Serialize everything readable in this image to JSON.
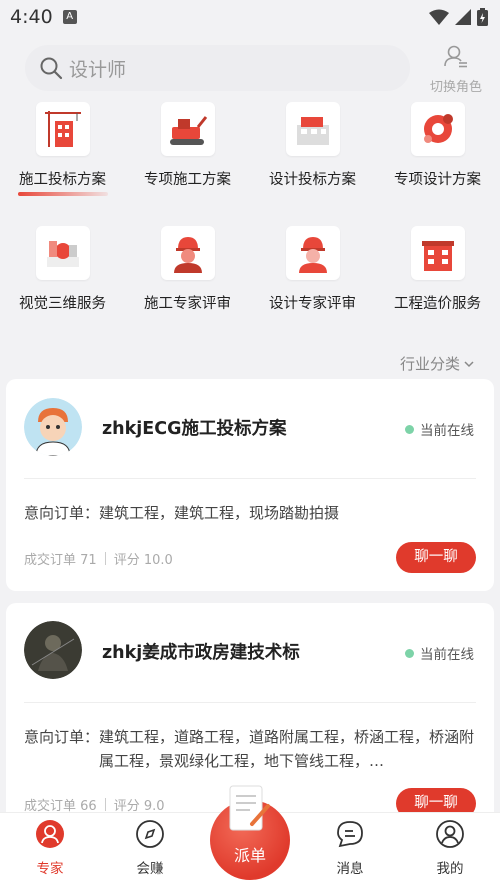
{
  "status_bar": {
    "time": "4:40",
    "a_icon": "A"
  },
  "search": {
    "placeholder": "设计师"
  },
  "header": {
    "switch_role": "切换角色"
  },
  "categories": [
    {
      "label": "施工投标方案",
      "icon": "crane-icon",
      "active": true
    },
    {
      "label": "专项施工方案",
      "icon": "excavator-icon"
    },
    {
      "label": "设计投标方案",
      "icon": "building-model-icon"
    },
    {
      "label": "专项设计方案",
      "icon": "gear-icon"
    },
    {
      "label": "视觉三维服务",
      "icon": "3d-render-icon"
    },
    {
      "label": "施工专家评审",
      "icon": "construction-worker-icon"
    },
    {
      "label": "设计专家评审",
      "icon": "designer-icon"
    },
    {
      "label": "工程造价服务",
      "icon": "house-cost-icon"
    }
  ],
  "filter": {
    "industry": "行业分类"
  },
  "experts": [
    {
      "name": "zhkjECG施工投标方案",
      "status": "当前在线",
      "intent_label": "意向订单：",
      "intent_text": "建筑工程，建筑工程，现场踏勘拍摄",
      "orders": "成交订单 71",
      "score": "评分 10.0",
      "chat": "聊一聊"
    },
    {
      "name": "zhkj姜成市政房建技术标",
      "status": "当前在线",
      "intent_label": "意向订单：",
      "intent_text": "建筑工程，道路工程，道路附属工程，桥涵工程，桥涵附属工程，景观绿化工程，地下管线工程，…",
      "orders": "成交订单 66",
      "score": "评分 9.0",
      "chat": "聊一聊"
    }
  ],
  "tabs": {
    "expert": "专家",
    "earn": "会赚",
    "dispatch": "派单",
    "messages": "消息",
    "mine": "我的"
  },
  "colors": {
    "accent": "#e03a2c",
    "online": "#7dd3a8"
  }
}
